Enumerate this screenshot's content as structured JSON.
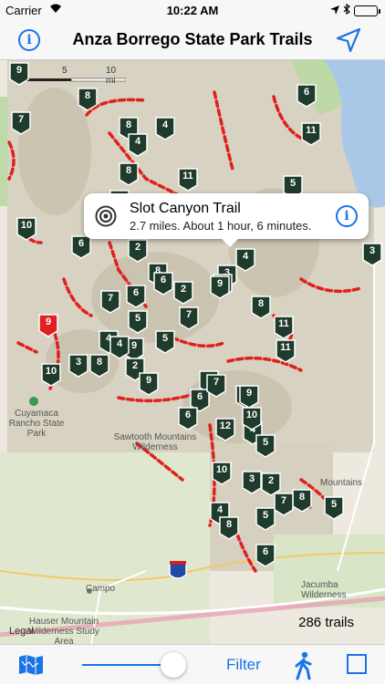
{
  "status_bar": {
    "carrier": "Carrier",
    "time": "10:22 AM"
  },
  "nav": {
    "title": "Anza Borrego State Park Trails",
    "info_icon": "info-icon",
    "location_icon": "location-arrow-icon"
  },
  "map": {
    "scale_labels": [
      "0",
      "5",
      "10 mi"
    ],
    "places": [
      "Cuyamaca Rancho State Park",
      "Sawtooth Mountains Wilderness",
      "Campo",
      "Jacumba Wilderness",
      "Hauser Mountain Wilderness Study Area",
      "Mountains"
    ],
    "highway": "8",
    "trail_markers": [
      "9",
      "8",
      "6",
      "7",
      "8",
      "4",
      "4",
      "11",
      "8",
      "7",
      "11",
      "5",
      "10",
      "6",
      "2",
      "4",
      "3",
      "8",
      "9",
      "7",
      "8",
      "6",
      "2",
      "9",
      "7",
      "5",
      "4",
      "9",
      "5",
      "3",
      "2",
      "6",
      "10",
      "8",
      "7",
      "9",
      "6",
      "7",
      "4",
      "9",
      "11",
      "12",
      "4",
      "10",
      "10",
      "5",
      "4",
      "3",
      "5",
      "9",
      "11",
      "2",
      "8",
      "7",
      "5",
      "6",
      "8",
      "3",
      "6"
    ],
    "selected_marker": "9",
    "legal": "Legal",
    "trail_count": "286 trails"
  },
  "callout": {
    "title": "Slot Canyon Trail",
    "subtitle": "2.7 miles. About 1 hour, 6 minutes.",
    "icon": "target-icon",
    "info_icon": "info-icon"
  },
  "toolbar": {
    "map_icon": "map-icon",
    "filter_label": "Filter",
    "walk_icon": "walking-person-icon",
    "stop_icon": "square-icon",
    "slider_value": 0.9
  },
  "colors": {
    "accent": "#1a73e8",
    "marker": "#1f3b2c",
    "marker_selected": "#e02020",
    "trail": "#e0201f"
  }
}
